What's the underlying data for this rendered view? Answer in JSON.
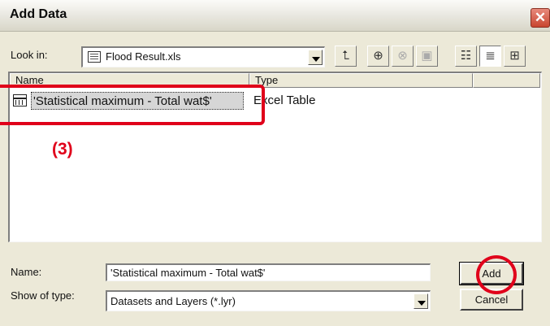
{
  "window": {
    "title": "Add Data",
    "close_glyph": "✕"
  },
  "look_in": {
    "label": "Look in:",
    "value": "Flood Result.xls",
    "icon": "spreadsheet-icon"
  },
  "toolbar": [
    {
      "name": "up-one-level-button",
      "icon": "folder-up-icon",
      "glyph": "⮤"
    },
    {
      "name": "connect-folder-button",
      "icon": "connect-folder-icon",
      "glyph": "⊕"
    },
    {
      "name": "disconnect-folder-button",
      "icon": "disconnect-folder-icon",
      "glyph": "⊗"
    },
    {
      "name": "new-button",
      "icon": "new-file-icon",
      "glyph": "▣"
    },
    {
      "name": "list-view-button",
      "icon": "list-view-icon",
      "glyph": "☷"
    },
    {
      "name": "details-view-button",
      "icon": "details-view-icon",
      "glyph": "≣"
    },
    {
      "name": "thumbnails-button",
      "icon": "thumbnails-icon",
      "glyph": "⊞"
    }
  ],
  "list": {
    "columns": [
      "Name",
      "Type"
    ],
    "rows": [
      {
        "name": "'Statistical maximum - Total wat$'",
        "type": "Excel Table",
        "icon": "table-icon"
      }
    ]
  },
  "annotation": {
    "label": "(3)",
    "color": "#e0001a"
  },
  "name_field": {
    "label": "Name:",
    "value": "'Statistical maximum - Total wat$'"
  },
  "show_of_type": {
    "label": "Show of type:",
    "value": "Datasets and Layers (*.lyr)"
  },
  "buttons": {
    "add": "Add",
    "cancel": "Cancel"
  }
}
